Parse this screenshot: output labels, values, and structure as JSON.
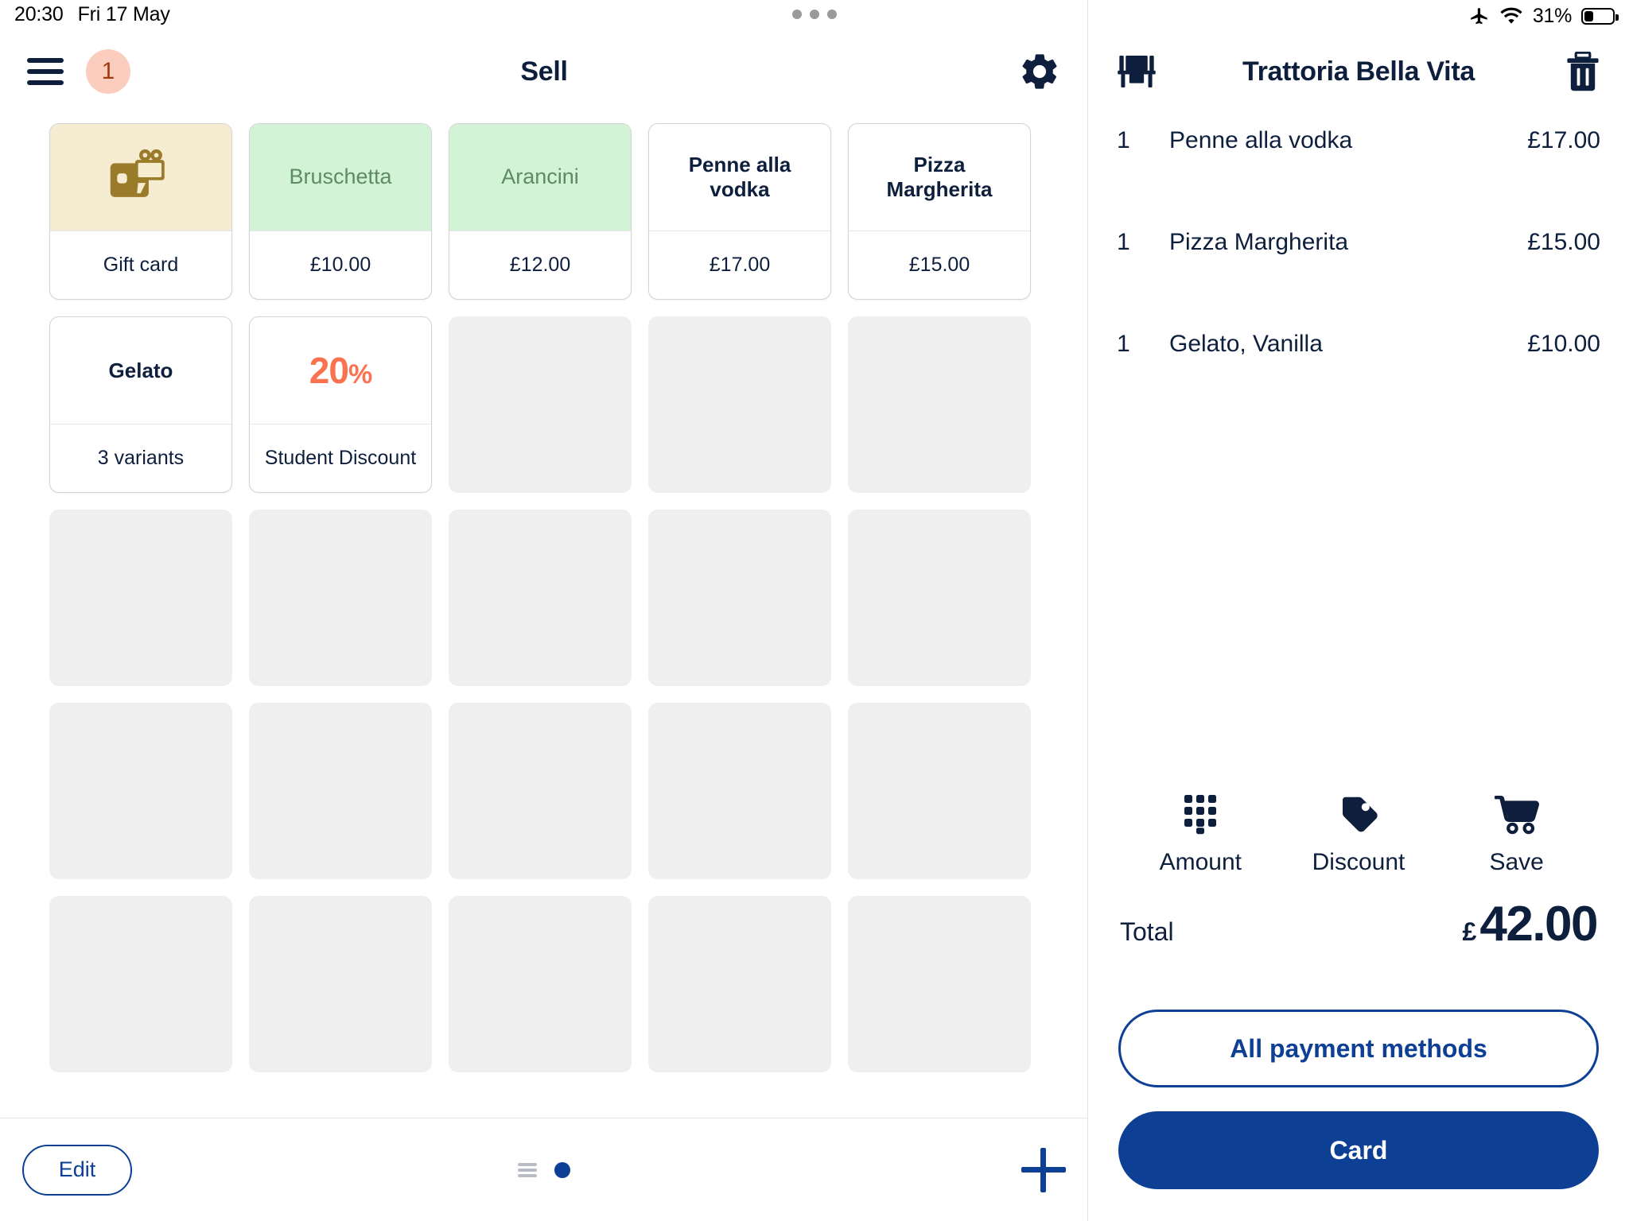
{
  "status_bar": {
    "time": "20:30",
    "date": "Fri 17 May",
    "battery_percent": "31%",
    "battery_level": 31,
    "airplane_icon": "airplane-icon",
    "wifi_icon": "wifi-icon",
    "multitask_icon": "multitasking-dots-icon"
  },
  "topbar": {
    "menu_icon": "hamburger-menu-icon",
    "badge_count": "1",
    "badge_color": "#fbcdbf",
    "badge_text_color": "#a33a12",
    "title": "Sell",
    "settings_icon": "gear-icon"
  },
  "grid": {
    "columns": 5,
    "rows": 5,
    "tiles": [
      {
        "name": "Gift card",
        "top_text": "",
        "bottom_text": "Gift card",
        "style": "cream",
        "icon": "gift-card-icon",
        "empty": false
      },
      {
        "name": "Bruschetta",
        "top_text": "Bruschetta",
        "bottom_text": "£10.00",
        "style": "green",
        "icon": "",
        "empty": false
      },
      {
        "name": "Arancini",
        "top_text": "Arancini",
        "bottom_text": "£12.00",
        "style": "green",
        "icon": "",
        "empty": false
      },
      {
        "name": "Penne alla vodka",
        "top_text": "Penne alla vodka",
        "bottom_text": "£17.00",
        "style": "plain",
        "icon": "",
        "empty": false
      },
      {
        "name": "Pizza Margherita",
        "top_text": "Pizza Margherita",
        "bottom_text": "£15.00",
        "style": "plain",
        "icon": "",
        "empty": false
      },
      {
        "name": "Gelato",
        "top_text": "Gelato",
        "bottom_text": "3 variants",
        "style": "plain",
        "icon": "",
        "empty": false
      },
      {
        "name": "Student Discount",
        "top_text": "20%",
        "bottom_text": "Student Discount",
        "style": "discount",
        "icon": "",
        "empty": false
      },
      {
        "name": "",
        "top_text": "",
        "bottom_text": "",
        "style": "",
        "icon": "",
        "empty": true
      },
      {
        "name": "",
        "top_text": "",
        "bottom_text": "",
        "style": "",
        "icon": "",
        "empty": true
      },
      {
        "name": "",
        "top_text": "",
        "bottom_text": "",
        "style": "",
        "icon": "",
        "empty": true
      },
      {
        "name": "",
        "top_text": "",
        "bottom_text": "",
        "style": "",
        "icon": "",
        "empty": true
      },
      {
        "name": "",
        "top_text": "",
        "bottom_text": "",
        "style": "",
        "icon": "",
        "empty": true
      },
      {
        "name": "",
        "top_text": "",
        "bottom_text": "",
        "style": "",
        "icon": "",
        "empty": true
      },
      {
        "name": "",
        "top_text": "",
        "bottom_text": "",
        "style": "",
        "icon": "",
        "empty": true
      },
      {
        "name": "",
        "top_text": "",
        "bottom_text": "",
        "style": "",
        "icon": "",
        "empty": true
      },
      {
        "name": "",
        "top_text": "",
        "bottom_text": "",
        "style": "",
        "icon": "",
        "empty": true
      },
      {
        "name": "",
        "top_text": "",
        "bottom_text": "",
        "style": "",
        "icon": "",
        "empty": true
      },
      {
        "name": "",
        "top_text": "",
        "bottom_text": "",
        "style": "",
        "icon": "",
        "empty": true
      },
      {
        "name": "",
        "top_text": "",
        "bottom_text": "",
        "style": "",
        "icon": "",
        "empty": true
      },
      {
        "name": "",
        "top_text": "",
        "bottom_text": "",
        "style": "",
        "icon": "",
        "empty": true
      },
      {
        "name": "",
        "top_text": "",
        "bottom_text": "",
        "style": "",
        "icon": "",
        "empty": true
      },
      {
        "name": "",
        "top_text": "",
        "bottom_text": "",
        "style": "",
        "icon": "",
        "empty": true
      },
      {
        "name": "",
        "top_text": "",
        "bottom_text": "",
        "style": "",
        "icon": "",
        "empty": true
      },
      {
        "name": "",
        "top_text": "",
        "bottom_text": "",
        "style": "",
        "icon": "",
        "empty": true
      },
      {
        "name": "",
        "top_text": "",
        "bottom_text": "",
        "style": "",
        "icon": "",
        "empty": true
      }
    ]
  },
  "bottombar": {
    "edit_label": "Edit",
    "list_view_icon": "list-view-icon",
    "page_dot_icon": "page-indicator-dot",
    "add_icon": "plus-icon"
  },
  "cart": {
    "table_icon": "table-icon",
    "title": "Trattoria Bella Vita",
    "delete_icon": "trash-icon",
    "items": [
      {
        "qty": "1",
        "name": "Penne alla vodka",
        "price": "£17.00"
      },
      {
        "qty": "1",
        "name": "Pizza Margherita",
        "price": "£15.00"
      },
      {
        "qty": "1",
        "name": "Gelato, Vanilla",
        "price": "£10.00"
      }
    ],
    "actions": [
      {
        "label": "Amount",
        "icon": "keypad-icon"
      },
      {
        "label": "Discount",
        "icon": "tag-icon"
      },
      {
        "label": "Save",
        "icon": "shopping-cart-icon"
      }
    ],
    "total_label": "Total",
    "total_currency": "£",
    "total_value": "42.00",
    "all_payment_methods_label": "All payment methods",
    "card_label": "Card"
  },
  "colors": {
    "navy": "#0d1f3c",
    "brand_blue": "#0d3f95",
    "green_tile": "#d2f3d6",
    "cream_tile": "#f6ecd2",
    "discount_orange": "#fa7250",
    "empty_tile": "#efefef"
  }
}
